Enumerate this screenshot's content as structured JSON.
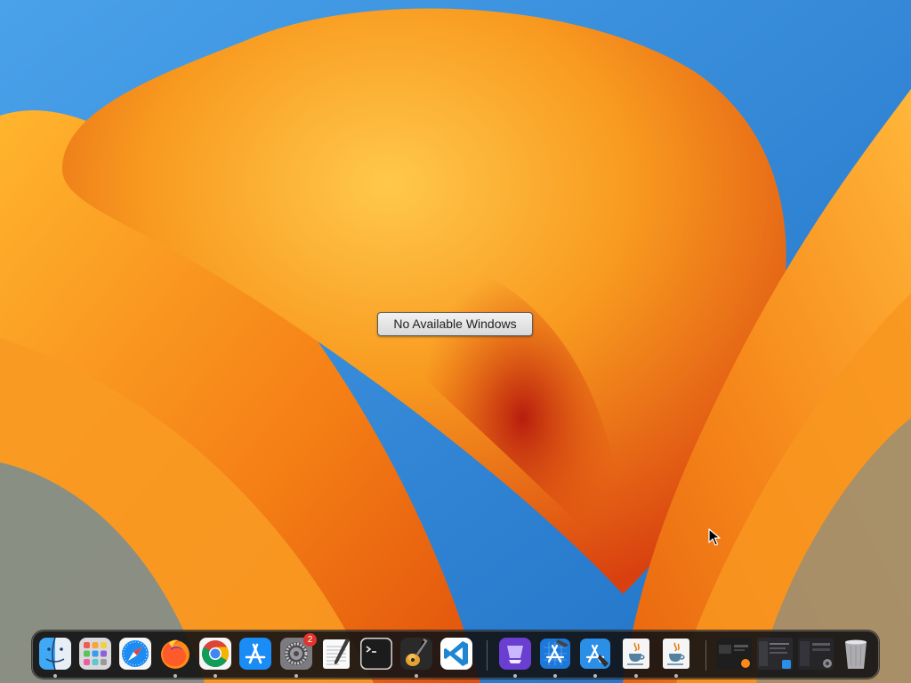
{
  "desktop": {
    "wallpaper": "macOS Ventura orange petals",
    "colors": {
      "sky": "#2f86d6",
      "petal_light": "#ffc440",
      "petal_mid": "#f7931e",
      "petal_dark": "#c8250e"
    }
  },
  "hud": {
    "label": "No Available Windows"
  },
  "dock": {
    "apps": [
      {
        "icon": "finder-icon",
        "running": true
      },
      {
        "icon": "launchpad-icon",
        "running": false
      },
      {
        "icon": "safari-icon",
        "running": false
      },
      {
        "icon": "firefox-icon",
        "running": true
      },
      {
        "icon": "chrome-icon",
        "running": true
      },
      {
        "icon": "app-store-icon",
        "running": false
      },
      {
        "icon": "system-settings-icon",
        "running": true,
        "badge": "2"
      },
      {
        "icon": "textedit-icon",
        "running": false
      },
      {
        "icon": "terminal-icon",
        "running": false
      },
      {
        "icon": "garageband-icon",
        "running": true
      },
      {
        "icon": "vscode-icon",
        "running": false
      },
      {
        "icon": "instruments-icon",
        "running": true
      },
      {
        "icon": "xcode-icon",
        "running": true
      },
      {
        "icon": "simulator-icon",
        "running": true
      },
      {
        "icon": "java-icon",
        "running": true
      },
      {
        "icon": "java-icon",
        "running": true
      }
    ],
    "minimized": [
      {
        "icon": "minimized-window-firefox-icon"
      },
      {
        "icon": "minimized-window-xcode-icon"
      },
      {
        "icon": "minimized-window-settings-icon"
      }
    ],
    "trash": {
      "icon": "trash-icon"
    }
  }
}
